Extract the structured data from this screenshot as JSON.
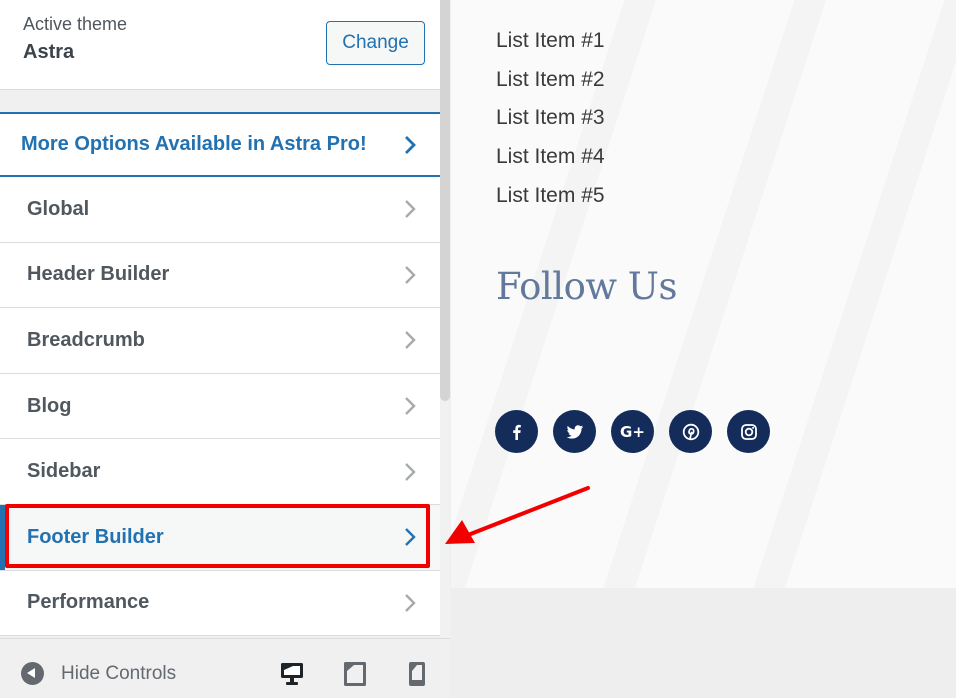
{
  "sidebar": {
    "active_theme_label": "Active theme",
    "theme_name": "Astra",
    "change_button": "Change",
    "pro_banner": "More Options Available in Astra Pro!",
    "items": [
      {
        "label": "Global",
        "active": false
      },
      {
        "label": "Header Builder",
        "active": false
      },
      {
        "label": "Breadcrumb",
        "active": false
      },
      {
        "label": "Blog",
        "active": false
      },
      {
        "label": "Sidebar",
        "active": false
      },
      {
        "label": "Footer Builder",
        "active": true
      },
      {
        "label": "Performance",
        "active": false
      }
    ],
    "footer": {
      "hide_controls_label": "Hide Controls",
      "devices": [
        "desktop",
        "tablet",
        "mobile"
      ],
      "active_device": "desktop"
    }
  },
  "preview": {
    "list_items": [
      "List Item #1",
      "List Item #2",
      "List Item #3",
      "List Item #4",
      "List Item #5"
    ],
    "follow_heading": "Follow Us",
    "social": [
      {
        "name": "facebook-icon",
        "label": "f"
      },
      {
        "name": "twitter-icon",
        "label": ""
      },
      {
        "name": "google-plus-icon",
        "label": "G+"
      },
      {
        "name": "pinterest-icon",
        "label": ""
      },
      {
        "name": "instagram-icon",
        "label": ""
      }
    ]
  },
  "annotation": {
    "highlight_color": "#f20000",
    "target": "Footer Builder"
  },
  "colors": {
    "accent": "#2271b1",
    "social_bg": "#142c5a",
    "heading": "#62799c"
  }
}
